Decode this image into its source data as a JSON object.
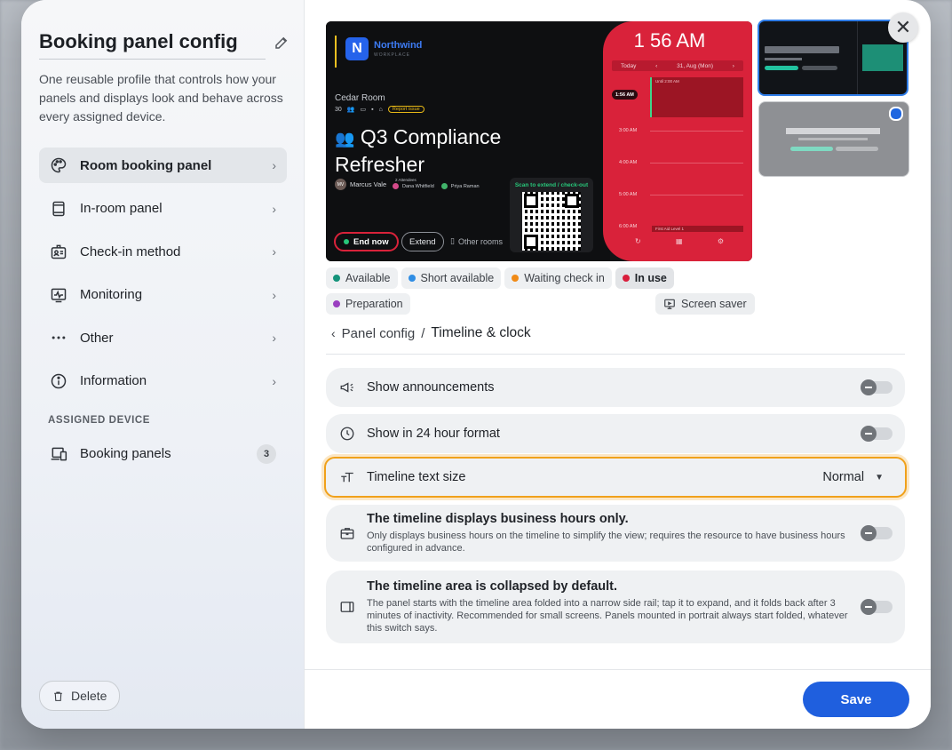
{
  "sidebar": {
    "title": "Booking panel config",
    "description": "One reusable profile that controls how your panels and displays look and behave across every assigned device.",
    "items": [
      {
        "label": "Room booking panel"
      },
      {
        "label": "In-room panel"
      },
      {
        "label": "Check-in method"
      },
      {
        "label": "Monitoring"
      },
      {
        "label": "Other"
      },
      {
        "label": "Information"
      }
    ],
    "assigned_heading": "ASSIGNED DEVICE",
    "assigned": {
      "label": "Booking panels",
      "count": "3"
    },
    "delete_label": "Delete"
  },
  "preview": {
    "brand": "Northwind",
    "brand_sub": "WORKPLACE",
    "room": "Cedar Room",
    "capacity": "30",
    "report_issue": "Report issue",
    "meeting_title": "Q3 Compliance Refresher",
    "organizer_initials": "MV",
    "organizer": "Marcus Vale",
    "attendees_label": "2 Attendees",
    "attendee_1": "Dana Whitfield",
    "attendee_2": "Priya Raman",
    "scan_label": "Scan to extend / check-out",
    "end_now": "End now",
    "extend": "Extend",
    "other_rooms": "Other rooms",
    "clock": "1 56 AM",
    "day_label": "Today",
    "date_label": "31, Aug (Mon)",
    "now_badge": "1:56 AM",
    "until_label": "Until 2:00 AM",
    "times": [
      "3:00 AM",
      "4:00 AM",
      "5:00 AM",
      "6:00 AM"
    ],
    "next_event": "First Aid Level 1"
  },
  "status_chips": [
    {
      "label": "Available",
      "color": "#14937a"
    },
    {
      "label": "Short available",
      "color": "#2f8de4"
    },
    {
      "label": "Waiting check in",
      "color": "#f08a16"
    },
    {
      "label": "In use",
      "color": "#d91e3c"
    },
    {
      "label": "Preparation",
      "color": "#9a3fc0"
    }
  ],
  "screen_saver_label": "Screen saver",
  "breadcrumb": {
    "parent": "Panel config",
    "separator": "/",
    "current": "Timeline & clock"
  },
  "settings": {
    "announcements": {
      "label": "Show announcements",
      "on": false
    },
    "hour24": {
      "label": "Show in 24 hour format",
      "on": false
    },
    "text_size": {
      "label": "Timeline text size",
      "value": "Normal"
    },
    "business_hours": {
      "title": "The timeline displays business hours only.",
      "desc": "Only displays business hours on the timeline to simplify the view; requires the resource to have business hours configured in advance.",
      "on": false
    },
    "collapsed": {
      "title": "The timeline area is collapsed by default.",
      "desc": "The panel starts with the timeline area folded into a narrow side rail; tap it to expand, and it folds back after 3 minutes of inactivity. Recommended for small screens. Panels mounted in portrait always start folded, whatever this switch says.",
      "on": false
    }
  },
  "footer": {
    "save_label": "Save"
  },
  "colors": {
    "accent": "#1f5fde",
    "focus": "#f0a11b",
    "in_use": "#d9223a"
  }
}
